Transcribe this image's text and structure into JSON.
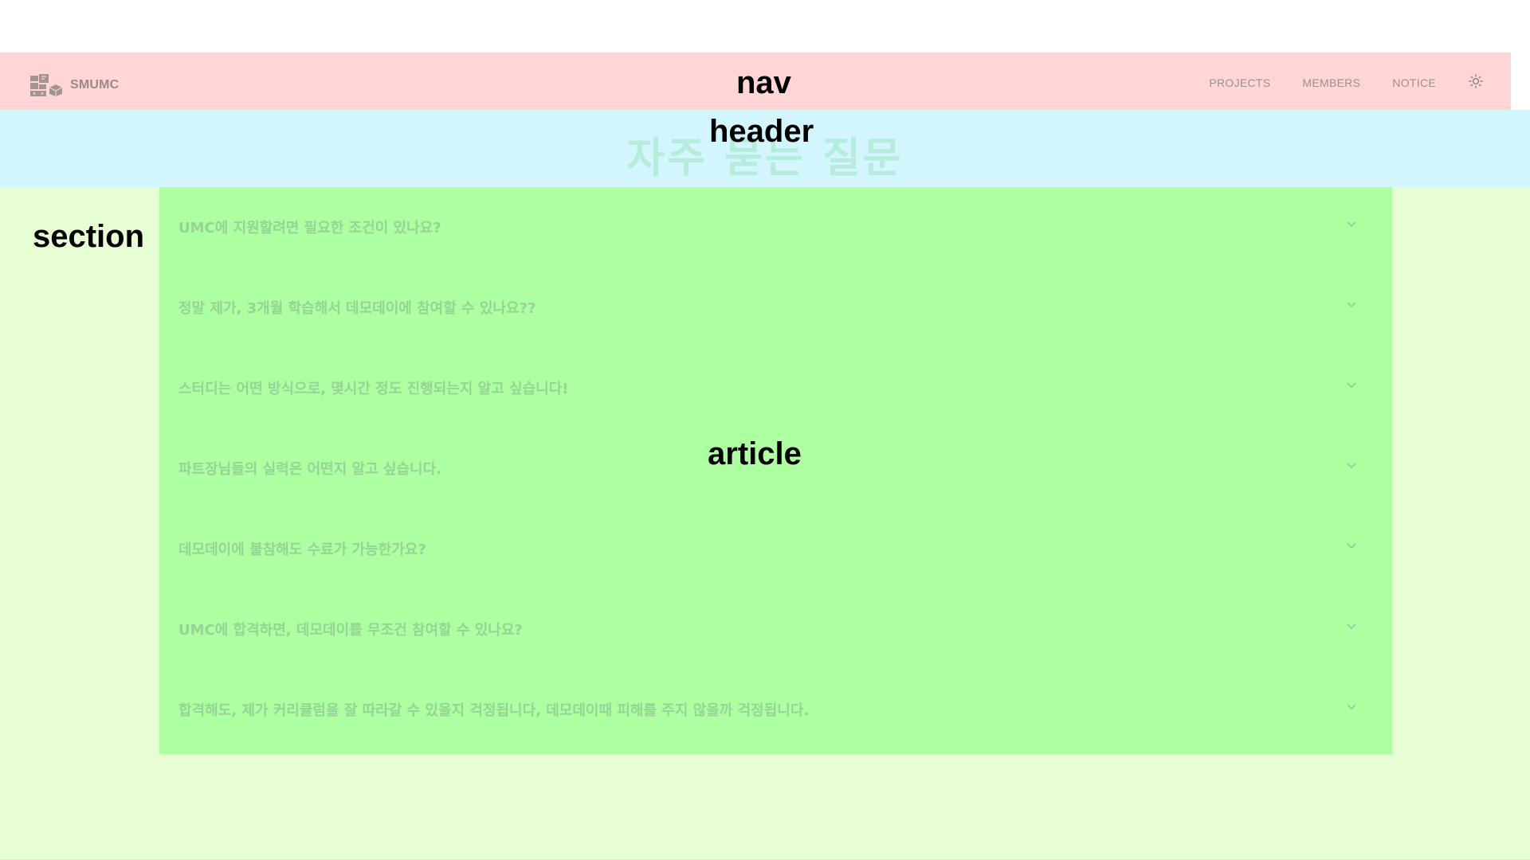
{
  "nav": {
    "brand": {
      "name": "SMUMC",
      "logo_icon": "boxes-logo-icon"
    },
    "links": [
      {
        "label": "PROJECTS"
      },
      {
        "label": "MEMBERS"
      },
      {
        "label": "NOTICE"
      }
    ],
    "theme_toggle_icon": "sun-icon"
  },
  "header": {
    "title": "자주 묻는 질문"
  },
  "faq": {
    "items": [
      {
        "question": "UMC에 지원할려면 필요한 조건이 있나요?"
      },
      {
        "question": "정말 제가, 3개월 학습해서 데모데이에 참여할 수 있나요??"
      },
      {
        "question": "스터디는 어떤 방식으로, 몇시간 정도 진행되는지 알고 싶습니다!"
      },
      {
        "question": "파트장님들의 실력은 어떤지 알고 싶습니다."
      },
      {
        "question": "데모데이에 불참해도 수료가 가능한가요?"
      },
      {
        "question": "UMC에 합격하면, 데모데이를 무조건 참여할 수 있나요?"
      },
      {
        "question": "합격해도, 제가 커리큘럼을 잘 따라갈 수 있을지 걱정됩니다, 데모데이때 피해를 주지 않을까 걱정됩니다."
      }
    ],
    "chevron_icon": "chevron-down-icon"
  },
  "debug_labels": {
    "nav": "nav",
    "header": "header",
    "section": "section",
    "article": "article"
  },
  "colors": {
    "nav_bg": "#ffd5d5",
    "header_bg": "#d3f5fd",
    "section_bg": "#e7fdd4",
    "article_bg": "#aefea2",
    "title_color": "#b6ecdc",
    "question_color": "#94d494"
  }
}
